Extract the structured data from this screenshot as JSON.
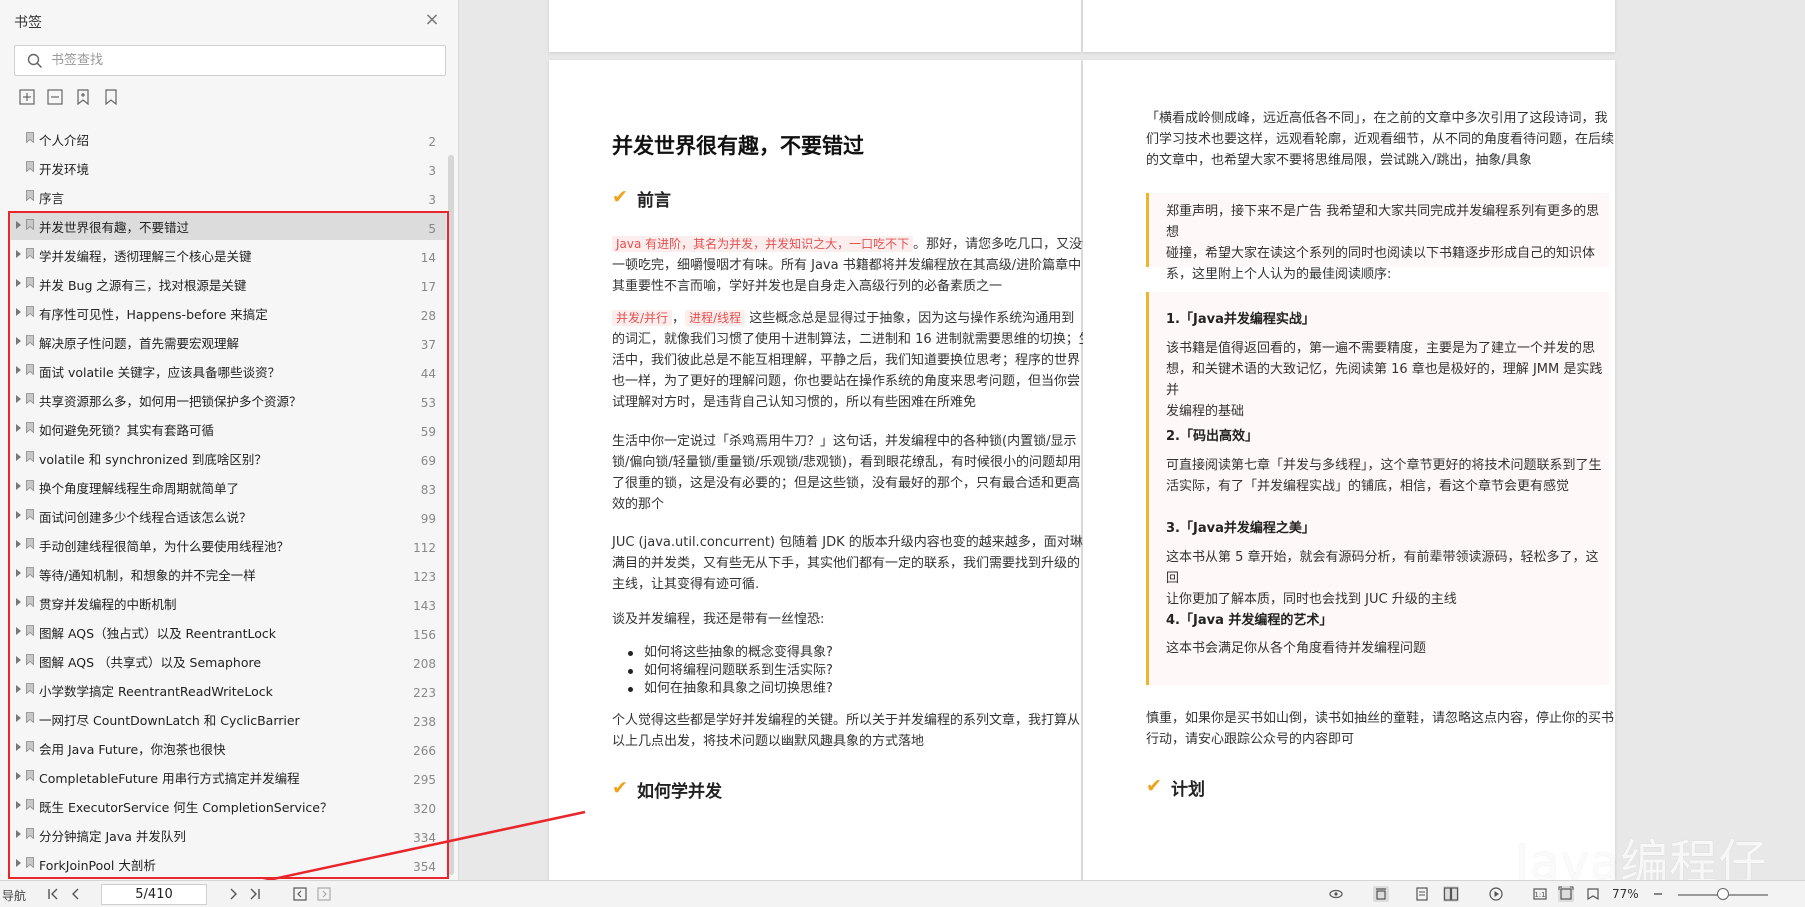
{
  "sidebar": {
    "title": "书签",
    "close_label": "×",
    "search": {
      "placeholder": "书签查找",
      "value": ""
    },
    "tools": [
      {
        "name": "expand-all-icon"
      },
      {
        "name": "collapse-all-icon"
      },
      {
        "name": "add-bookmark-icon"
      },
      {
        "name": "bookmark-icon"
      }
    ],
    "items": [
      {
        "label": "个人介绍",
        "page": "2",
        "children": false
      },
      {
        "label": "开发环境",
        "page": "3",
        "children": false
      },
      {
        "label": "序言",
        "page": "3",
        "children": false
      },
      {
        "label": "并发世界很有趣，不要错过",
        "page": "5",
        "children": true,
        "active": true
      },
      {
        "label": "学并发编程，透彻理解三个核心是关键",
        "page": "14",
        "children": true
      },
      {
        "label": "并发 Bug 之源有三，找对根源是关键",
        "page": "17",
        "children": true
      },
      {
        "label": "有序性可见性，Happens-before 来搞定",
        "page": "28",
        "children": true
      },
      {
        "label": "解决原子性问题，首先需要宏观理解",
        "page": "37",
        "children": true
      },
      {
        "label": "面试 volatile 关键字，应该具备哪些谈资？",
        "page": "44",
        "children": true
      },
      {
        "label": "共享资源那么多，如何用一把锁保护多个资源？",
        "page": "53",
        "children": true
      },
      {
        "label": "如何避免死锁？其实有套路可循",
        "page": "59",
        "children": true
      },
      {
        "label": "volatile 和 synchronized 到底啥区别？",
        "page": "69",
        "children": true
      },
      {
        "label": "换个角度理解线程生命周期就简单了",
        "page": "83",
        "children": true
      },
      {
        "label": "面试问创建多少个线程合适该怎么说？",
        "page": "99",
        "children": true
      },
      {
        "label": "手动创建线程很简单，为什么要使用线程池？",
        "page": "112",
        "children": true
      },
      {
        "label": "等待/通知机制，和想象的并不完全一样",
        "page": "123",
        "children": true
      },
      {
        "label": "贯穿并发编程的中断机制",
        "page": "143",
        "children": true
      },
      {
        "label": "图解 AQS（独占式）以及 ReentrantLock",
        "page": "156",
        "children": true
      },
      {
        "label": "图解 AQS （共享式）以及 Semaphore",
        "page": "208",
        "children": true
      },
      {
        "label": "小学数学搞定 ReentrantReadWriteLock",
        "page": "223",
        "children": true
      },
      {
        "label": "一网打尽 CountDownLatch 和 CyclicBarrier",
        "page": "238",
        "children": true
      },
      {
        "label": "会用 Java Future，你泡茶也很快",
        "page": "266",
        "children": true
      },
      {
        "label": "CompletableFuture 用串行方式搞定并发编程",
        "page": "295",
        "children": true
      },
      {
        "label": "既生 ExecutorService 何生 CompletionService？",
        "page": "320",
        "children": true
      },
      {
        "label": "分分钟搞定 Java 并发队列",
        "page": "334",
        "children": true
      },
      {
        "label": "ForkJoinPool 大剖析",
        "page": "354",
        "children": true
      }
    ]
  },
  "left_page": {
    "title": "并发世界很有趣，不要错过",
    "section1": "前言",
    "p1_tag": "Java 有进阶，其名为并发，并发知识之大，一口吃不下",
    "p1_line1": "。那好，请您多吃几口，又没说",
    "p1_line2": "一顿吃完，细嚼慢咽才有味。所有 Java 书籍都将并发编程放在其高级/进阶篇章中，",
    "p1_line3": "其重要性不言而喻，学好并发也是自身走入高级行列的必备素质之一",
    "p2_tag1": "并发/并行",
    "p2_sep": "，",
    "p2_tag2": "进程/线程",
    "p2_line1": " 这些概念总是显得过于抽象，因为这与操作系统沟通用到",
    "p2_line2": "的词汇，就像我们习惯了使用十进制算法，二进制和 16 进制就需要思维的切换；生",
    "p2_line3": "活中，我们彼此总是不能互相理解，平静之后，我们知道要换位思考；程序的世界",
    "p2_line4": "也一样，为了更好的理解问题，你也要站在操作系统的角度来思考问题，但当你尝",
    "p2_line5": "试理解对方时，是违背自己认知习惯的，所以有些困难在所难免",
    "p3_line1": "生活中你一定说过「杀鸡焉用牛刀？」这句话，并发编程中的各种锁(内置锁/显示",
    "p3_line2": "锁/偏向锁/轻量锁/重量锁/乐观锁/悲观锁)，看到眼花缭乱，有时候很小的问题却用",
    "p3_line3": "了很重的锁，这是没有必要的；但是这些锁，没有最好的那个，只有最合适和更高",
    "p3_line4": "效的那个",
    "p4_line1": "JUC (java.util.concurrent) 包随着 JDK 的版本升级内容也变的越来越多，面对琳琅",
    "p4_line2": "满目的并发类，又有些无从下手，其实他们都有一定的联系，我们需要找到升级的",
    "p4_line3": "主线，让其变得有迹可循.",
    "p5": "谈及并发编程，我还是带有一丝惶恐:",
    "bullets": [
      "如何将这些抽象的概念变得具象?",
      "如何将编程问题联系到生活实际?",
      "如何在抽象和具象之间切换思维?"
    ],
    "p6_line1": "个人觉得这些都是学好并发编程的关键。所以关于并发编程的系列文章，我打算从",
    "p6_line2": "以上几点出发，将技术问题以幽默风趣具象的方式落地",
    "section2": "如何学并发"
  },
  "right_page": {
    "p1_line1": "「横看成岭侧成峰，远近高低各不同」，在之前的文章中多次引用了这段诗词，我",
    "p1_line2": "们学习技术也要这样，远观看轮廓，近观看细节，从不同的角度看待问题，在后续",
    "p1_line3": "的文章中，也希望大家不要将思维局限，尝试跳入/跳出，抽象/具象",
    "q1_line1": "郑重声明，接下来不是广告 我希望和大家共同完成并发编程系列有更多的思想",
    "q1_line2": "碰撞，希望大家在读这个系列的同时也阅读以下书籍逐步形成自己的知识体",
    "q1_line3": "系，这里附上个人认为的最佳阅读顺序:",
    "book1": "1.「Java并发编程实战」",
    "book1_line1": "该书籍是值得返回看的，第一遍不需要精度，主要是为了建立一个并发的思",
    "book1_line2": "想，和关键术语的大致记忆，先阅读第 16 章也是极好的，理解 JMM 是实践并",
    "book1_line3": "发编程的基础",
    "book2": "2.「码出高效」",
    "book2_line1": "可直接阅读第七章「并发与多线程」，这个章节更好的将技术问题联系到了生",
    "book2_line2": "活实际，有了「并发编程实战」的铺底，相信，看这个章节会更有感觉",
    "book3": "3.「Java并发编程之美」",
    "book3_line1": "这本书从第 5 章开始，就会有源码分析，有前辈带领读源码，轻松多了，这回",
    "book3_line2": "让你更加了解本质，同时也会找到 JUC 升级的主线",
    "book4": "4.「Java 并发编程的艺术」",
    "book4_line1": "这本书会满足你从各个角度看待并发编程问题",
    "p2_line1": "慎重，如果你是买书如山倒，读书如抽丝的童鞋，请忽略这点内容，停止你的买书",
    "p2_line2": "行动，请安心跟踪公众号的内容即可",
    "section": "计划"
  },
  "watermark": "Java编程仔",
  "statusbar": {
    "nav_label": "导航",
    "page_value": "5/410",
    "zoom": "77%",
    "zoom_level": 0.5
  },
  "colors": {
    "highlight_box": "#e8262b",
    "accent_check": "#f0a21b",
    "quote_border": "#f0b429",
    "tag_text": "#e25151"
  }
}
